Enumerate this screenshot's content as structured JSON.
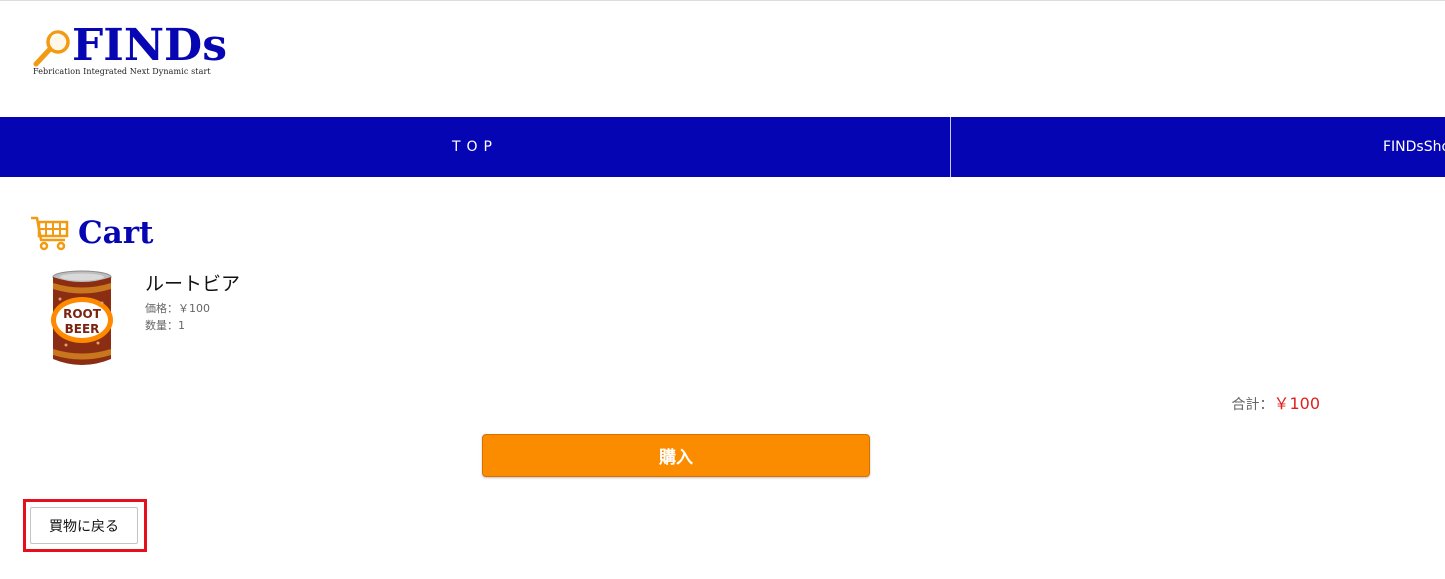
{
  "logo": {
    "name": "FINDs",
    "tagline": "Febrication Integrated Next Dynamic start",
    "icon": "magnifier-icon"
  },
  "nav": {
    "items": [
      {
        "label": "TOP"
      },
      {
        "label": "FINDsShop"
      }
    ]
  },
  "cart": {
    "title": "Cart",
    "icon": "shopping-cart-icon",
    "items": [
      {
        "name": "ルートビア",
        "price": "価格：￥100",
        "quantity": "数量：1",
        "image_text": [
          "ROOT",
          "BEER"
        ]
      }
    ],
    "total_label": "合計：",
    "total_value": "￥100"
  },
  "buttons": {
    "purchase": "購入",
    "back": "買物に戻る"
  },
  "colors": {
    "brand_blue": "#0505b3",
    "accent_orange": "#fb8c00",
    "price_red": "#e02020",
    "highlight_red": "#e4101e"
  }
}
